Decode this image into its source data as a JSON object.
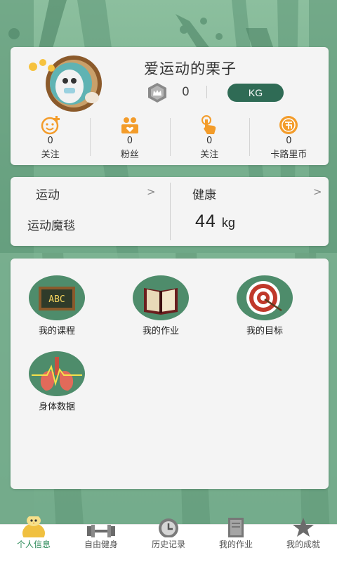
{
  "profile": {
    "username": "爱运动的栗子",
    "crown_count": "0",
    "unit": "KG",
    "stats": [
      {
        "icon": "smile-plus-icon",
        "count": "0",
        "label": "关注"
      },
      {
        "icon": "fans-icon",
        "count": "0",
        "label": "粉丝"
      },
      {
        "icon": "pointer-icon",
        "count": "0",
        "label": "关注"
      },
      {
        "icon": "coin-icon",
        "count": "0",
        "label": "卡路里币"
      }
    ]
  },
  "sport": {
    "left_title": "运动",
    "left_value": "运动魔毯",
    "right_title": "健康",
    "weight_value": "44",
    "weight_unit": "kg",
    "arrow": ">"
  },
  "features": [
    {
      "icon": "abc-board-icon",
      "label": "我的课程"
    },
    {
      "icon": "book-icon",
      "label": "我的作业"
    },
    {
      "icon": "target-icon",
      "label": "我的目标"
    },
    {
      "icon": "lungs-icon",
      "label": "身体数据"
    }
  ],
  "nav": [
    {
      "icon": "chick-icon",
      "label": "个人信息",
      "active": true
    },
    {
      "icon": "dumbbell-icon",
      "label": "自由健身",
      "active": false
    },
    {
      "icon": "history-icon",
      "label": "历史记录",
      "active": false
    },
    {
      "icon": "homework-icon",
      "label": "我的作业",
      "active": false
    },
    {
      "icon": "star-icon",
      "label": "我的成就",
      "active": false
    }
  ],
  "colors": {
    "accent": "#2f6b55",
    "orange": "#f39c2a",
    "feature_bg": "#4e8c6b",
    "nav_active": "#2e8b5a"
  }
}
